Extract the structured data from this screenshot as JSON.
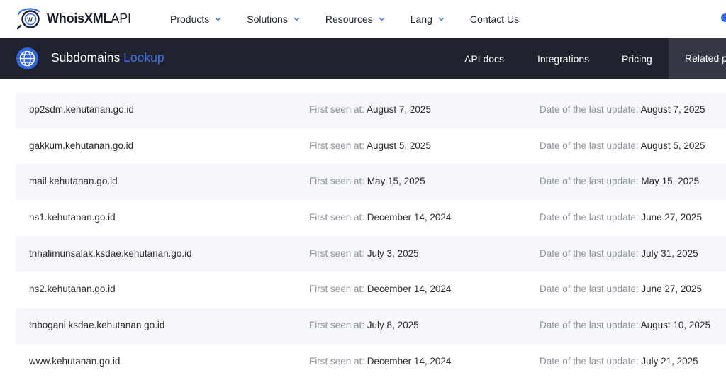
{
  "colors": {
    "accent": "#3b73ee",
    "product_bar": "#20232e",
    "row_shade": "#f6f7fa"
  },
  "topnav": {
    "brand": {
      "name": "WhoisXML",
      "suffix": "API"
    },
    "menu": [
      {
        "label": "Products",
        "dropdown": true
      },
      {
        "label": "Solutions",
        "dropdown": true
      },
      {
        "label": "Resources",
        "dropdown": true
      },
      {
        "label": "Lang",
        "dropdown": true
      },
      {
        "label": "Contact Us",
        "dropdown": false
      }
    ]
  },
  "product_bar": {
    "title_main": "Subdomains",
    "title_accent": "Lookup",
    "links": [
      "API docs",
      "Integrations",
      "Pricing"
    ],
    "related_label": "Related pr"
  },
  "results": {
    "first_seen_label": "First seen at:",
    "last_update_label": "Date of the last update:",
    "rows": [
      {
        "domain": "bp2sdm.kehutanan.go.id",
        "first_seen": "August 7, 2025",
        "last_update": "August 7, 2025"
      },
      {
        "domain": "gakkum.kehutanan.go.id",
        "first_seen": "August 5, 2025",
        "last_update": "August 5, 2025"
      },
      {
        "domain": "mail.kehutanan.go.id",
        "first_seen": "May 15, 2025",
        "last_update": "May 15, 2025"
      },
      {
        "domain": "ns1.kehutanan.go.id",
        "first_seen": "December 14, 2024",
        "last_update": "June 27, 2025"
      },
      {
        "domain": "tnhalimunsalak.ksdae.kehutanan.go.id",
        "first_seen": "July 3, 2025",
        "last_update": "July 31, 2025"
      },
      {
        "domain": "ns2.kehutanan.go.id",
        "first_seen": "December 14, 2024",
        "last_update": "June 27, 2025"
      },
      {
        "domain": "tnbogani.ksdae.kehutanan.go.id",
        "first_seen": "July 8, 2025",
        "last_update": "August 10, 2025"
      },
      {
        "domain": "www.kehutanan.go.id",
        "first_seen": "December 14, 2024",
        "last_update": "July 21, 2025"
      }
    ]
  }
}
